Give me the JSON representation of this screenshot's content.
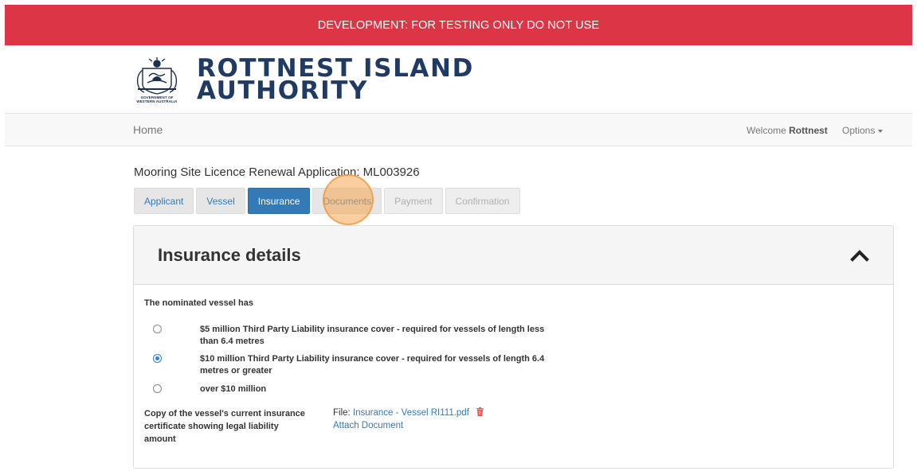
{
  "banner": {
    "text": "DEVELOPMENT: FOR TESTING ONLY DO NOT USE",
    "color": "#dc3545"
  },
  "logo": {
    "line1": "ROTTNEST ISLAND",
    "line2": "AUTHORITY",
    "crest_caption_line1": "GOVERNMENT OF",
    "crest_caption_line2": "WESTERN AUSTRALIA",
    "color": "#1f3a63"
  },
  "navbar": {
    "home": "Home",
    "welcome_prefix": "Welcome",
    "user_name": "Rottnest",
    "options": "Options"
  },
  "page_title": "Mooring Site Licence Renewal Application: ML003926",
  "tabs": [
    {
      "label": "Applicant",
      "state": "enabled"
    },
    {
      "label": "Vessel",
      "state": "enabled"
    },
    {
      "label": "Insurance",
      "state": "active"
    },
    {
      "label": "Documents",
      "state": "enabled"
    },
    {
      "label": "Payment",
      "state": "disabled"
    },
    {
      "label": "Confirmation",
      "state": "disabled"
    }
  ],
  "panel": {
    "title": "Insurance details",
    "intro": "The nominated vessel has",
    "options": [
      {
        "label": "$5 million Third Party Liability insurance cover - required for vessels of length less than 6.4 metres",
        "checked": false
      },
      {
        "label": "$10 million Third Party Liability insurance cover - required for vessels of length 6.4 metres or greater",
        "checked": true
      },
      {
        "label": "over $10 million",
        "checked": false
      }
    ],
    "upload_label": "Copy of the vessel's current insurance certificate showing legal liability amount",
    "file_prefix": "File:",
    "file_name": "Insurance - Vessel RI111.pdf",
    "attach_label": "Attach Document"
  },
  "colors": {
    "primary": "#337ab7",
    "danger": "#dc3545",
    "accent_highlight": "#f5a650"
  },
  "icons": [
    "crest-logo",
    "caret-down-icon",
    "chevron-up-icon",
    "trash-icon"
  ]
}
